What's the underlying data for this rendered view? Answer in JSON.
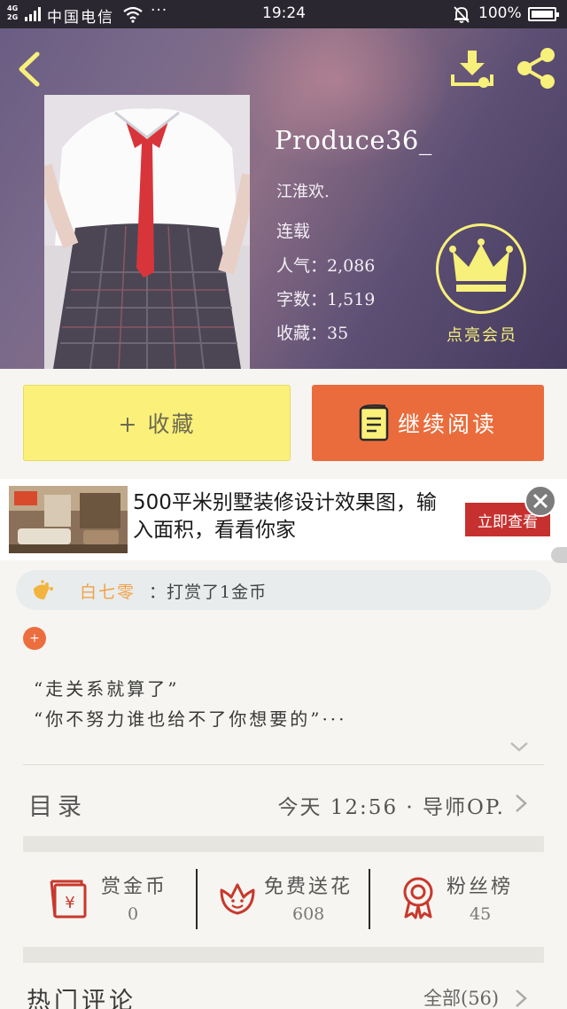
{
  "status_bar": {
    "network": "4G\n2G",
    "carrier": "中国电信",
    "more": "···",
    "time": "19:24",
    "battery": "100%"
  },
  "book": {
    "title": "Produce36_",
    "author": "江淮欢.",
    "status": "连载",
    "popularity": "人气：2,086",
    "word_count": "字数：1,519",
    "favorites": "收藏：35"
  },
  "vip": {
    "label": "点亮会员"
  },
  "actions": {
    "collect": "+ 收藏",
    "continue_reading": "继续阅读"
  },
  "ad": {
    "text": "500平米别墅装修设计效果图，输入面积，看看你家",
    "cta": "立即查看"
  },
  "ticker": {
    "user": "白七零",
    "action": "：打赏了1金币"
  },
  "intro": {
    "tag": "+",
    "line1": "“走关系就算了”",
    "line2": "“你不努力谁也给不了你想要的”···"
  },
  "toc": {
    "label": "目录",
    "updated": "今天 12:56 · 导师OP."
  },
  "stats": {
    "reward": {
      "label": "赏金币",
      "value": "0"
    },
    "flowers": {
      "label": "免费送花",
      "value": "608"
    },
    "fans": {
      "label": "粉丝榜",
      "value": "45"
    }
  },
  "comments": {
    "title": "热门评论",
    "all": "全部(56)"
  },
  "colors": {
    "accent_yellow": "#fbf17a",
    "accent_orange": "#ea6c3c",
    "icon_red": "#c8382c",
    "ticker_name": "#f0a34b"
  }
}
